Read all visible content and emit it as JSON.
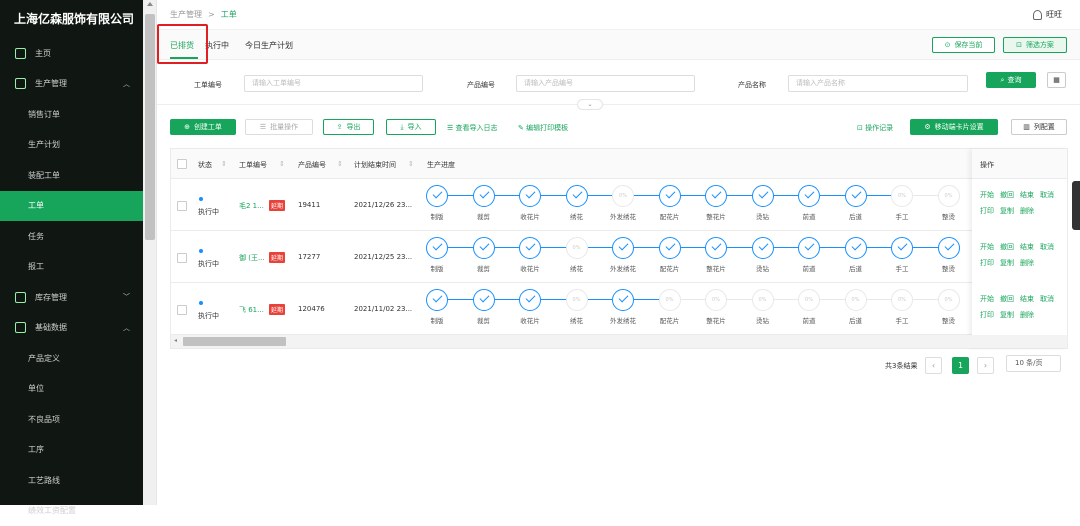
{
  "sidebar": {
    "brand": "上海亿森服饰有限公司",
    "items": [
      {
        "label": "主页"
      },
      {
        "label": "生产管理"
      },
      {
        "label": "销售订单"
      },
      {
        "label": "生产计划"
      },
      {
        "label": "装配工单"
      },
      {
        "label": "工单"
      },
      {
        "label": "任务"
      },
      {
        "label": "报工"
      },
      {
        "label": "库存管理"
      },
      {
        "label": "基础数据"
      },
      {
        "label": "产品定义"
      },
      {
        "label": "单位"
      },
      {
        "label": "不良品项"
      },
      {
        "label": "工序"
      },
      {
        "label": "工艺路线"
      },
      {
        "label": "绩效工资配置"
      }
    ]
  },
  "header": {
    "breadcrumb_parent": "生产管理",
    "breadcrumb_sep": ">",
    "breadcrumb_current": "工单",
    "user": "旺旺"
  },
  "tabs": [
    "已排货",
    "执行中",
    "今日生产计划"
  ],
  "actions": {
    "save_current": "保存当前",
    "filter_plan": "筛选方案",
    "query": "查询"
  },
  "filters": [
    {
      "label": "工单编号",
      "placeholder": "请输入工单编号"
    },
    {
      "label": "产品编号",
      "placeholder": "请输入产品编号"
    },
    {
      "label": "产品名称",
      "placeholder": "请输入产品名称"
    }
  ],
  "toolbar": {
    "create": "创建工单",
    "batch": "批量操作",
    "export": "导出",
    "import": "导入",
    "import_log": "查看导入日志",
    "edit_print": "编辑打印模板",
    "op_record": "操作记录",
    "mobile_card": "移动端卡片设置",
    "col_config": "列配置"
  },
  "columns": [
    "状态",
    "工单编号",
    "产品编号",
    "计划结束时间",
    "生产进度",
    "操作"
  ],
  "step_names": [
    "制版",
    "裁剪",
    "收花片",
    "绣花",
    "外发绣花",
    "配花片",
    "整花片",
    "烫钻",
    "前道",
    "后道",
    "手工",
    "整烫"
  ],
  "rows": [
    {
      "status": "执行中",
      "wo": "毛2 1...",
      "tag": "延期",
      "product": "19411",
      "end": "2021/12/26 23...",
      "steps": [
        "done",
        "done",
        "done",
        "done",
        "0%",
        "done",
        "done",
        "done",
        "done",
        "done",
        "0%",
        "0%"
      ]
    },
    {
      "status": "执行中",
      "wo": "御 (王...",
      "tag": "延期",
      "product": "17277",
      "end": "2021/12/25 23...",
      "steps": [
        "done",
        "done",
        "done",
        "0%",
        "done",
        "done",
        "done",
        "done",
        "done",
        "done",
        "done",
        "done"
      ]
    },
    {
      "status": "执行中",
      "wo": "飞 61...",
      "tag": "延期",
      "product": "120476",
      "end": "2021/11/02 23...",
      "steps": [
        "done",
        "done",
        "done",
        "0%",
        "done",
        "0%",
        "0%",
        "0%",
        "0%",
        "0%",
        "0%",
        "0%"
      ]
    }
  ],
  "op_links": [
    "开始",
    "撤回",
    "结束",
    "取消",
    "打印",
    "复制",
    "删除"
  ],
  "pager": {
    "total": "共3条结果",
    "page": "1",
    "size": "10 条/页"
  },
  "colors": {
    "accent": "#17a55b",
    "progress": "#1890ff",
    "tag": "#e8433b",
    "sidebar_bg": "#101712"
  }
}
